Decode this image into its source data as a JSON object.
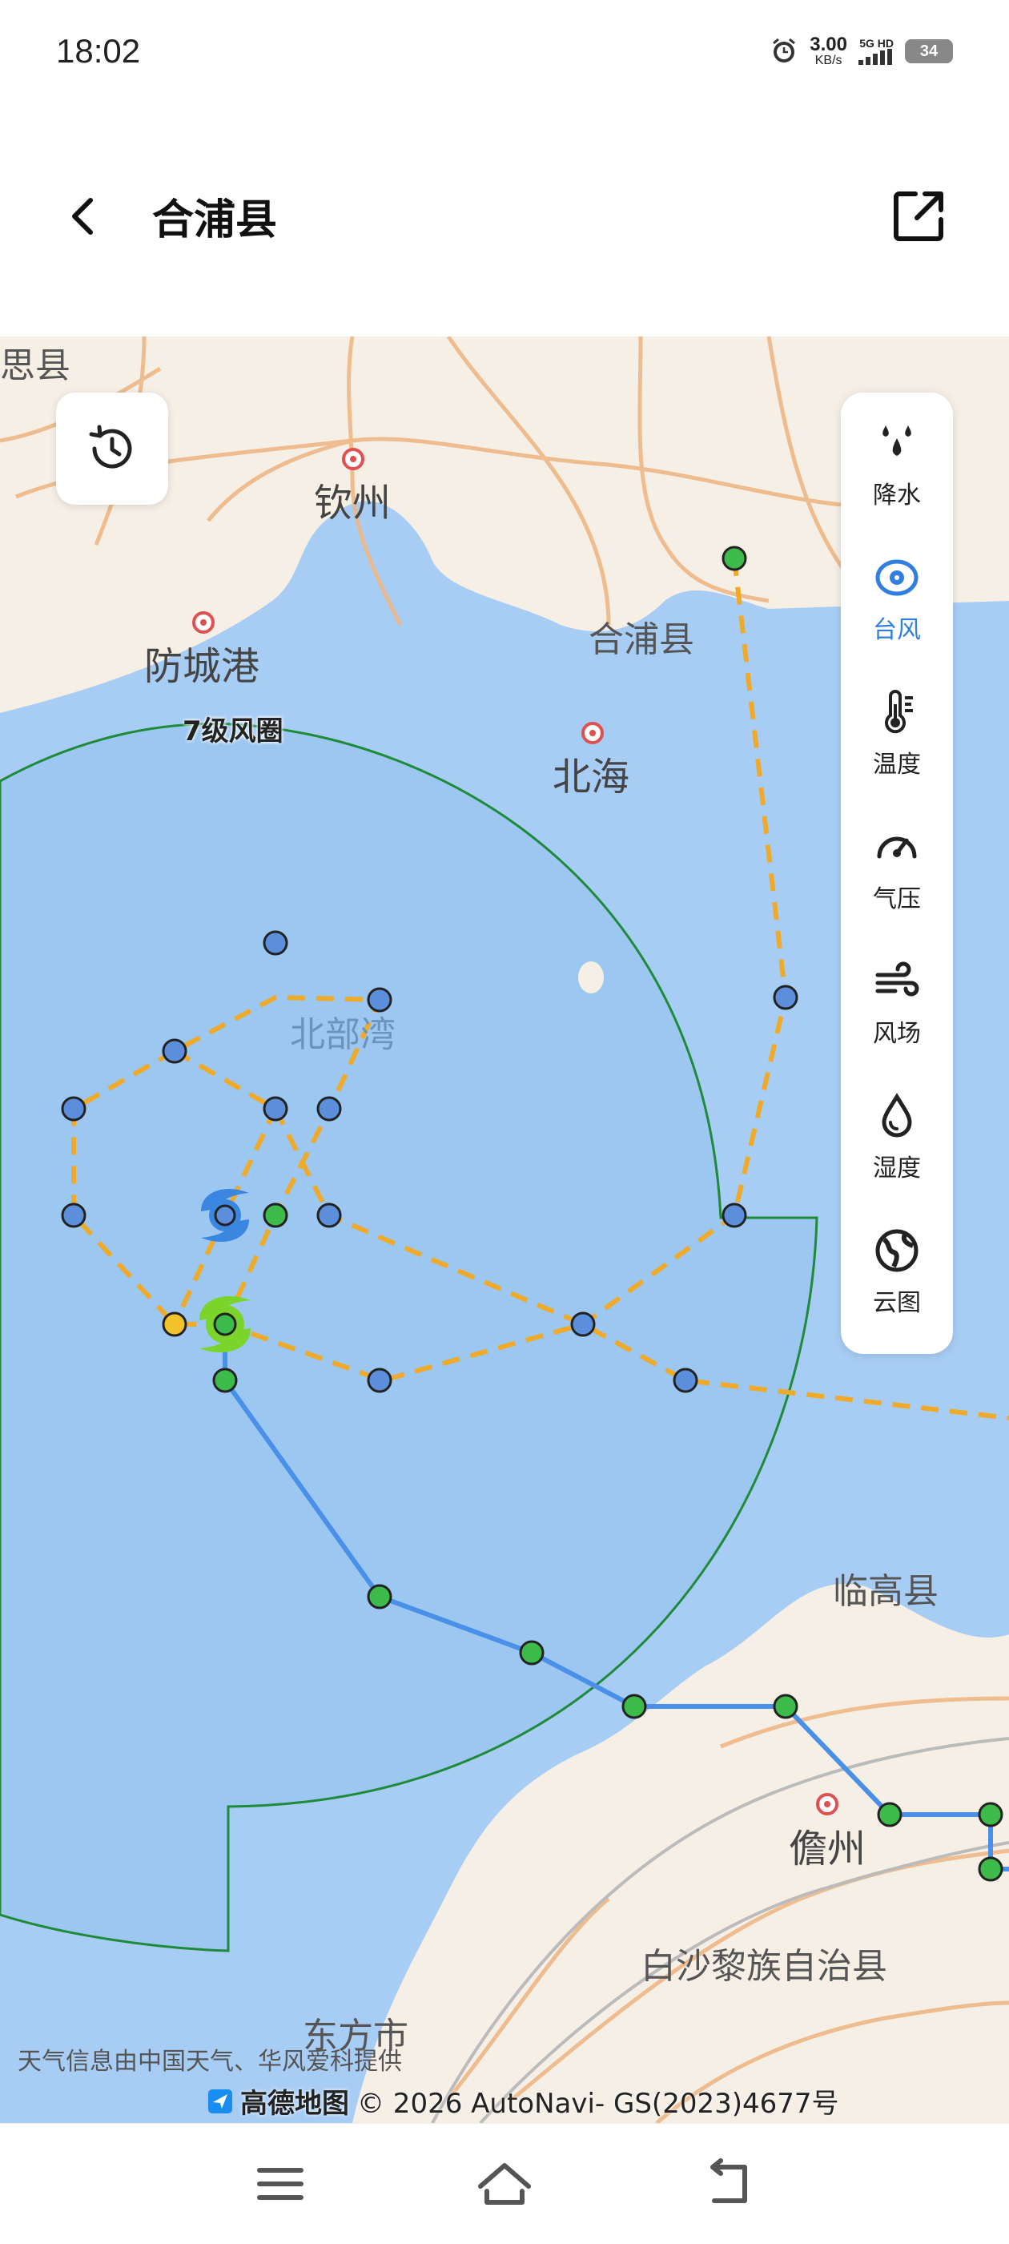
{
  "status_bar": {
    "time": "18:02",
    "net_speed_value": "3.00",
    "net_speed_unit": "KB/s",
    "network_type": "5G HD",
    "battery": "34"
  },
  "header": {
    "title": "合浦县",
    "back_icon": "chevron-left-icon",
    "share_icon": "share-external-icon"
  },
  "map": {
    "labels": {
      "top_left_cut": "思县",
      "qinzhou": "钦州",
      "fangchenggang": "防城港",
      "hepu": "合浦县",
      "beihai": "北海",
      "gulf": "北部湾",
      "lingao": "临高县",
      "danzhou": "儋州",
      "baisha": "白沙黎族自治县",
      "dongfang": "东方市",
      "wind_circle": "7级风圈"
    },
    "credit": "天气信息由中国天气、华风爱科提供",
    "copyright_brand": "高德地图",
    "copyright": "© 2026 AutoNavi- GS(2023)4677号",
    "colors": {
      "sea": "#a8cdf5",
      "land": "#f5efe6",
      "wind_circle_fill": "#9cc7f0",
      "wind_circle_stroke": "#1e8a3a",
      "forecast_track": "#f0aa2a",
      "past_track": "#4a90e8",
      "point_green": "#3cba4a",
      "point_blue": "#5b8fdb",
      "point_yellow": "#f3c32b"
    }
  },
  "history_button": {
    "icon": "history-icon"
  },
  "layer_panel": {
    "items": [
      {
        "label": "降水",
        "icon": "rain-drops-icon",
        "active": false
      },
      {
        "label": "台风",
        "icon": "typhoon-eye-icon",
        "active": true
      },
      {
        "label": "温度",
        "icon": "thermometer-icon",
        "active": false
      },
      {
        "label": "气压",
        "icon": "pressure-gauge-icon",
        "active": false
      },
      {
        "label": "风场",
        "icon": "wind-icon",
        "active": false
      },
      {
        "label": "湿度",
        "icon": "humidity-drop-icon",
        "active": false
      },
      {
        "label": "云图",
        "icon": "globe-cloud-icon",
        "active": false
      }
    ]
  },
  "nav_bar": {
    "menu_icon": "menu-icon",
    "home_icon": "home-icon",
    "back_icon": "back-icon"
  }
}
